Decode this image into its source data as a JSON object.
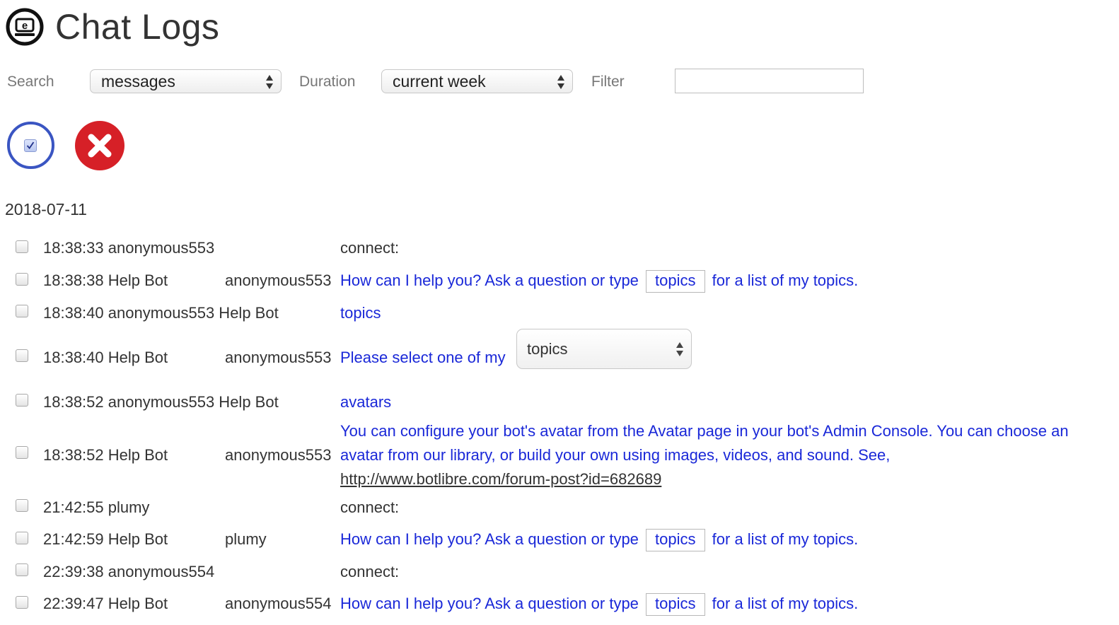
{
  "header": {
    "title": "Chat Logs",
    "logo_icon": "e-logo-icon"
  },
  "controls": {
    "search_label": "Search",
    "search_value": "messages",
    "duration_label": "Duration",
    "duration_value": "current week",
    "filter_label": "Filter",
    "filter_value": ""
  },
  "actions": {
    "select_icon": "select-all-checkbox-icon",
    "delete_icon": "delete-x-icon"
  },
  "colors": {
    "link_blue": "#1a28d8",
    "select_ring": "#3a55c2",
    "delete_red": "#d62027"
  },
  "log": {
    "date": "2018-07-11",
    "rows": [
      {
        "time_speaker": "18:38:33 anonymous553",
        "target": "",
        "message": "connect:"
      },
      {
        "time_speaker": "18:38:38 Help Bot",
        "target": "anonymous553",
        "msg_pre": "How can I help you? Ask a question or type",
        "msg_btn": "topics",
        "msg_post": "for a list of my topics."
      },
      {
        "time_speaker": "18:38:40 anonymous553 Help Bot",
        "target": "",
        "message": "topics"
      },
      {
        "time_speaker": "18:38:40 Help Bot",
        "target": "anonymous553",
        "msg_pre": "Please select one of my",
        "select_value": "topics"
      },
      {
        "time_speaker": "18:38:52 anonymous553 Help Bot",
        "target": "",
        "message": "avatars"
      },
      {
        "time_speaker": "18:38:52 Help Bot",
        "target": "anonymous553",
        "message": "You can configure your bot's avatar from the Avatar page in your bot's Admin Console. You can choose an avatar from our library, or build your own using images, videos, and sound. See,",
        "link": "http://www.botlibre.com/forum-post?id=682689"
      },
      {
        "time_speaker": "21:42:55 plumy",
        "target": "",
        "message": "connect:"
      },
      {
        "time_speaker": "21:42:59 Help Bot",
        "target": "plumy",
        "msg_pre": "How can I help you? Ask a question or type",
        "msg_btn": "topics",
        "msg_post": "for a list of my topics."
      },
      {
        "time_speaker": "22:39:38 anonymous554",
        "target": "",
        "message": "connect:"
      },
      {
        "time_speaker": "22:39:47 Help Bot",
        "target": "anonymous554",
        "msg_pre": "How can I help you? Ask a question or type",
        "msg_btn": "topics",
        "msg_post": "for a list of my topics."
      }
    ]
  }
}
